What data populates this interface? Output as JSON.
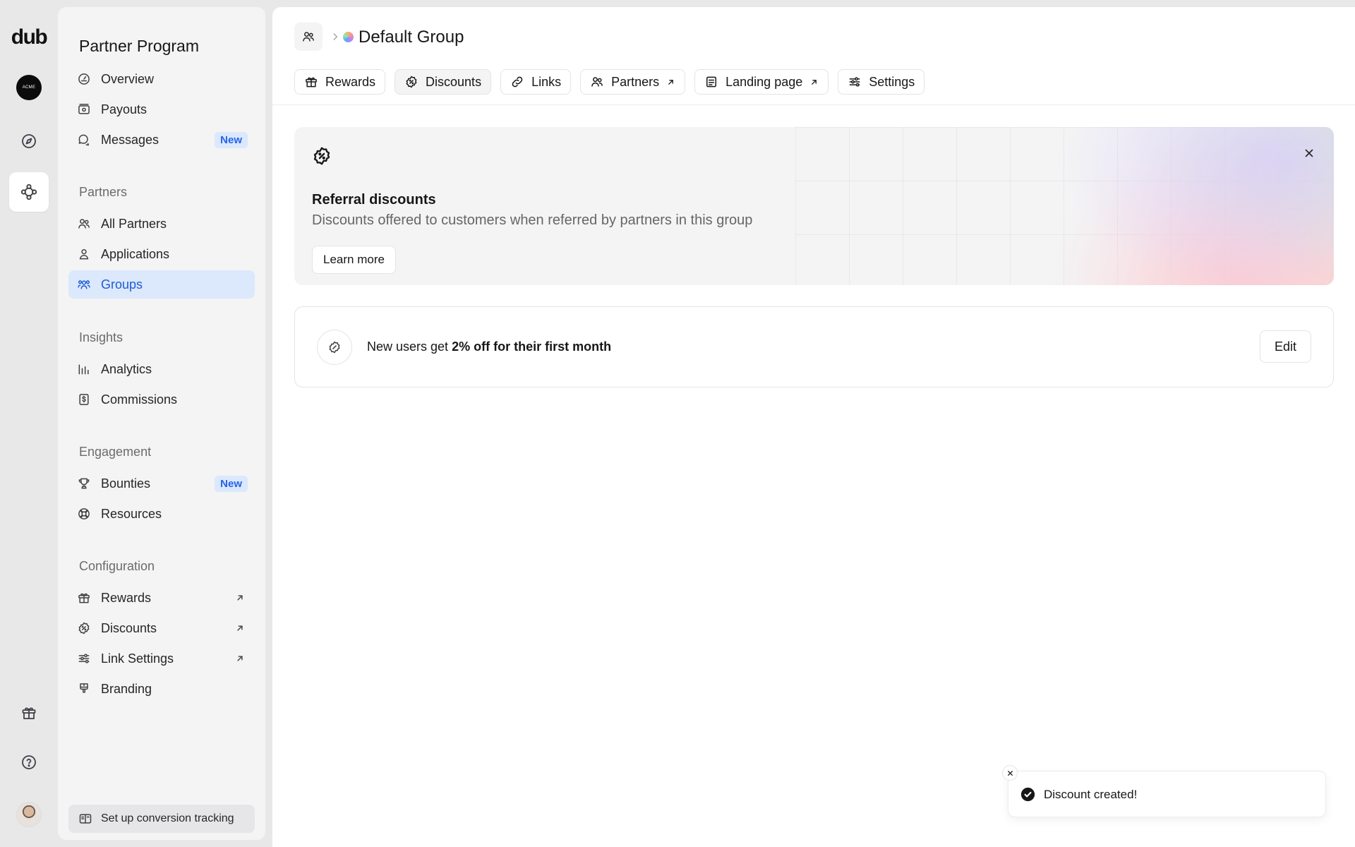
{
  "rail": {
    "logo": "dub",
    "workspace_avatar_text": "ACME",
    "icons": [
      "compass-icon",
      "network-icon",
      "gift-icon",
      "help-icon"
    ]
  },
  "sidebar": {
    "title": "Partner Program",
    "top_items": [
      {
        "label": "Overview",
        "icon": "overview-icon"
      },
      {
        "label": "Payouts",
        "icon": "payouts-icon"
      },
      {
        "label": "Messages",
        "icon": "messages-icon",
        "badge": "New"
      }
    ],
    "partners_section": {
      "label": "Partners",
      "items": [
        {
          "label": "All Partners",
          "icon": "users-icon"
        },
        {
          "label": "Applications",
          "icon": "user-icon"
        },
        {
          "label": "Groups",
          "icon": "groups-icon",
          "active": true
        }
      ]
    },
    "insights_section": {
      "label": "Insights",
      "items": [
        {
          "label": "Analytics",
          "icon": "analytics-icon"
        },
        {
          "label": "Commissions",
          "icon": "commissions-icon"
        }
      ]
    },
    "engagement_section": {
      "label": "Engagement",
      "items": [
        {
          "label": "Bounties",
          "icon": "trophy-icon",
          "badge": "New"
        },
        {
          "label": "Resources",
          "icon": "lifebuoy-icon"
        }
      ]
    },
    "configuration_section": {
      "label": "Configuration",
      "items": [
        {
          "label": "Rewards",
          "icon": "gift-icon",
          "external": true
        },
        {
          "label": "Discounts",
          "icon": "discount-icon",
          "external": true
        },
        {
          "label": "Link Settings",
          "icon": "sliders-icon",
          "external": true
        },
        {
          "label": "Branding",
          "icon": "brush-icon"
        }
      ]
    },
    "setup_button": "Set up conversion tracking"
  },
  "header": {
    "title": "Default Group"
  },
  "tabs": [
    {
      "label": "Rewards",
      "icon": "gift-icon"
    },
    {
      "label": "Discounts",
      "icon": "discount-icon",
      "active": true
    },
    {
      "label": "Links",
      "icon": "link-icon"
    },
    {
      "label": "Partners",
      "icon": "users-icon",
      "external": true
    },
    {
      "label": "Landing page",
      "icon": "page-icon",
      "external": true
    },
    {
      "label": "Settings",
      "icon": "sliders-icon"
    }
  ],
  "banner": {
    "title": "Referral discounts",
    "description": "Discounts offered to customers when referred by partners in this group",
    "button": "Learn more"
  },
  "discount": {
    "text_prefix": "New users get",
    "amount": "2% off",
    "duration": "for their first month",
    "edit_label": "Edit"
  },
  "toast": {
    "message": "Discount created!"
  },
  "colors": {
    "accent": "#1d5bd8",
    "active_bg": "#dce8fb",
    "badge_bg": "#dbe8fd",
    "badge_text": "#2563eb"
  }
}
